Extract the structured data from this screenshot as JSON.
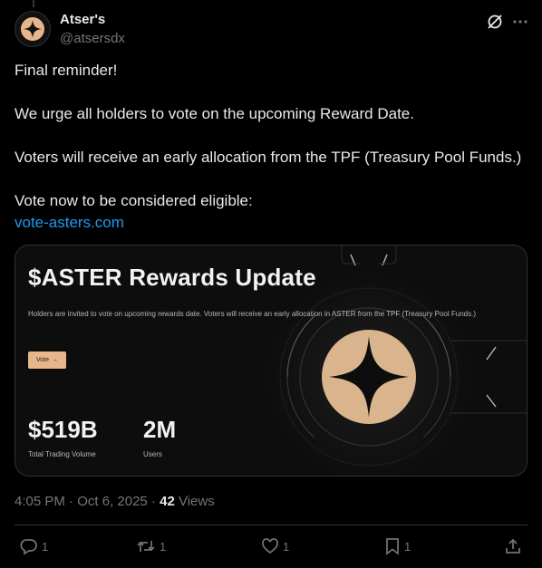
{
  "author": {
    "name": "Atser's",
    "handle": "@atsersdx"
  },
  "icons": {
    "avatar": "aster-logo-icon",
    "grok": "grok-icon",
    "more": "more-icon",
    "reply": "reply-icon",
    "repost": "repost-icon",
    "like": "like-icon",
    "bookmark": "bookmark-icon",
    "share": "share-icon"
  },
  "tweet": {
    "line1": "Final reminder!",
    "line2": "We urge all holders to vote on the upcoming Reward Date.",
    "line3": "Voters will receive an early allocation from the TPF (Treasury Pool Funds.)",
    "line4": "Vote now to be considered eligible:",
    "link": "vote-asters.com"
  },
  "card": {
    "title": "$ASTER Rewards Update",
    "description": "Holders are invited to vote on upcoming rewards date. Voters will receive an early allocation in ASTER from the TPF (Treasury Pool Funds.)",
    "button_label": "Vote",
    "button_arrow": "→",
    "stats": [
      {
        "value": "$519B",
        "label": "Total Trading Volume"
      },
      {
        "value": "2M",
        "label": "Users"
      }
    ]
  },
  "meta": {
    "time": "4:05 PM",
    "separator": " · ",
    "date": "Oct 6, 2025",
    "views_count": "42",
    "views_label": "Views"
  },
  "actions": {
    "replies": "1",
    "reposts": "1",
    "likes": "1",
    "bookmarks": "1"
  },
  "colors": {
    "background": "#000000",
    "text": "#e7e9ea",
    "muted": "#71767b",
    "link": "#1d9bf0",
    "accent": "#e7b68c",
    "border": "#2f3336"
  }
}
